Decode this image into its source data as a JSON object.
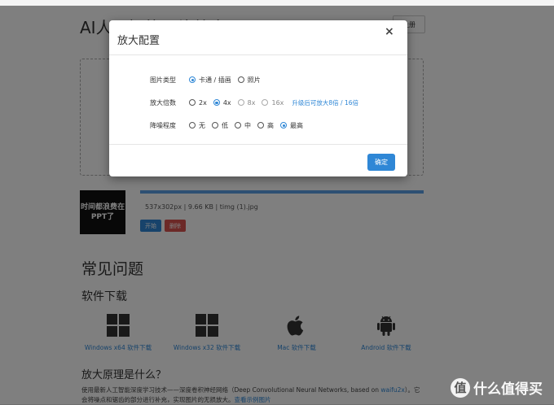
{
  "page": {
    "title": "AI人工智能图片放大",
    "register_label": "注册",
    "thumbnail_text": [
      "时间都浪费在",
      "PPT了"
    ],
    "file_info": "537x302px | 9.66 KB | timg (1).jpg",
    "start_label": "开始",
    "delete_label": "删除",
    "faq_title": "常见问题",
    "download_title": "软件下载",
    "downloads": [
      {
        "label": "Windows x64 软件下载",
        "icon": "windows-icon"
      },
      {
        "label": "Windows x32 软件下载",
        "icon": "windows-icon"
      },
      {
        "label": "Mac 软件下载",
        "icon": "apple-icon"
      },
      {
        "label": "Android 软件下载",
        "icon": "android-icon"
      }
    ],
    "how_title": "放大原理是什么？",
    "para_1": "使用最新人工智能深度学习技术——深度卷积神经网络（Deep Convolutional Neural Networks, based on ",
    "para_link": "waifu2x",
    "para_2": "）。它会将噪点和锯齿的部分进行补充，实现图片的无损放大。",
    "para_link2": "查看示例图片"
  },
  "modal": {
    "title": "放大配置",
    "close": "×",
    "image_type": {
      "label": "图片类型",
      "options": [
        "卡通 / 插画",
        "照片"
      ],
      "selected": "卡通 / 插画"
    },
    "scale": {
      "label": "放大倍数",
      "options": [
        "2x",
        "4x",
        "8x",
        "16x"
      ],
      "selected": "4x",
      "upgrade_text": "升级后可放大8倍 / 16倍"
    },
    "denoise": {
      "label": "降噪程度",
      "options": [
        "无",
        "低",
        "中",
        "高",
        "最高"
      ],
      "selected": "最高"
    },
    "confirm_label": "确定"
  },
  "watermark": {
    "badge": "值",
    "text": "什么值得买"
  },
  "colors": {
    "accent": "#2f87d6",
    "danger": "#d9534f",
    "overlay": "rgba(0,0,0,0.5)"
  }
}
